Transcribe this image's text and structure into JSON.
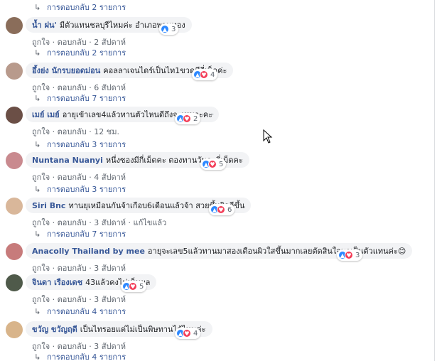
{
  "reply_arrow": "↳",
  "comments": [
    {
      "author": "น้ำ ฝน'",
      "text": "มีตัวแทนชลบุรีไหมค่ะ อำเภอพานทอง",
      "like": "ถูกใจ",
      "reply": "ตอบกลับ",
      "time": "2 สัปดาห์",
      "reactions": [
        "like"
      ],
      "reaction_count": "3",
      "edited": "",
      "avatar_color": "#8a6d5a"
    },
    {
      "author": "อึ้งย่ง นักรบยอดม่อน",
      "text": "คอลลาเจนไดร์เป็นไท1ขวดมีกี่เม็ดค่ะ",
      "like": "ถูกใจ",
      "reply": "ตอบกลับ",
      "time": "6 สัปดาห์",
      "reactions": [
        "like",
        "love"
      ],
      "reaction_count": "4",
      "edited": "",
      "avatar_color": "#b89a8c"
    },
    {
      "author": "เมย์ เมย์",
      "text": "อายุเข้าเลข4แล้วทานตัวไหนดีถึงจะเหมาะคะ",
      "like": "ถูกใจ",
      "reply": "ตอบกลับ",
      "time": "12 ชม.",
      "reactions": [
        "like",
        "love"
      ],
      "reaction_count": "2",
      "edited": "",
      "avatar_color": "#6b4f46"
    },
    {
      "author": "Nuntana Nuanyi",
      "text": "หนึ่งซองมีกี่เม็ดคะ ตองทานวันละกี่เม็ดคะ",
      "like": "ถูกใจ",
      "reply": "ตอบกลับ",
      "time": "4 สัปดาห์",
      "reactions": [
        "like",
        "love"
      ],
      "reaction_count": "5",
      "edited": "",
      "avatar_color": "#c98a8f"
    },
    {
      "author": "Siri Bnc",
      "text": "ทานยุเหมือนกันจ้าเกือบ6เดือนแล้วจ้า สวยขึ้นผิวดีขึ้น",
      "like": "ถูกใจ",
      "reply": "ตอบกลับ",
      "time": "3 สัปดาห์",
      "reactions": [
        "like",
        "love"
      ],
      "reaction_count": "6",
      "edited": "แก้ไขแล้ว",
      "avatar_color": "#d9b79a"
    },
    {
      "author": "Anacolly Thailand by mee",
      "text": "อายุจะเลข5แล้วทานมาสองเดือนผิวใสขึ้นมากเลยตัดสินใจมาเป็นตัวแทนค่ะ😊",
      "like": "ถูกใจ",
      "reply": "ตอบกลับ",
      "time": "3 สัปดาห์",
      "reactions": [
        "like",
        "love"
      ],
      "reaction_count": "3",
      "edited": "",
      "avatar_color": "#c77b7b"
    },
    {
      "author": "จินดา เรืองเดช",
      "text": "43แล้วคงไม่เห็นผล",
      "like": "ถูกใจ",
      "reply": "ตอบกลับ",
      "time": "3 สัปดาห์",
      "reactions": [
        "like",
        "love"
      ],
      "reaction_count": "5",
      "edited": "",
      "avatar_color": "#4f5a4a"
    },
    {
      "author": "ขวัญ ขวัญฤดี",
      "text": "เป็นไทรอยแต่ไม่เป็นพิษทานได้ไหมค่ะ",
      "like": "ถูกใจ",
      "reply": "ตอบกลับ",
      "time": "3 สัปดาห์",
      "reactions": [
        "like",
        "love"
      ],
      "reaction_count": "4",
      "edited": "",
      "avatar_color": "#d8b48a"
    }
  ],
  "reply_links": [
    "การตอบกลับ 2 รายการ",
    "การตอบกลับ 2 รายการ",
    "การตอบกลับ 7 รายการ",
    "การตอบกลับ 3 รายการ",
    "การตอบกลับ 3 รายการ",
    "การตอบกลับ 7 รายการ",
    "การตอบกลับ 4 รายการ",
    "การตอบกลับ 4 รายการ"
  ],
  "more_options": "···",
  "meta_separator": "·"
}
